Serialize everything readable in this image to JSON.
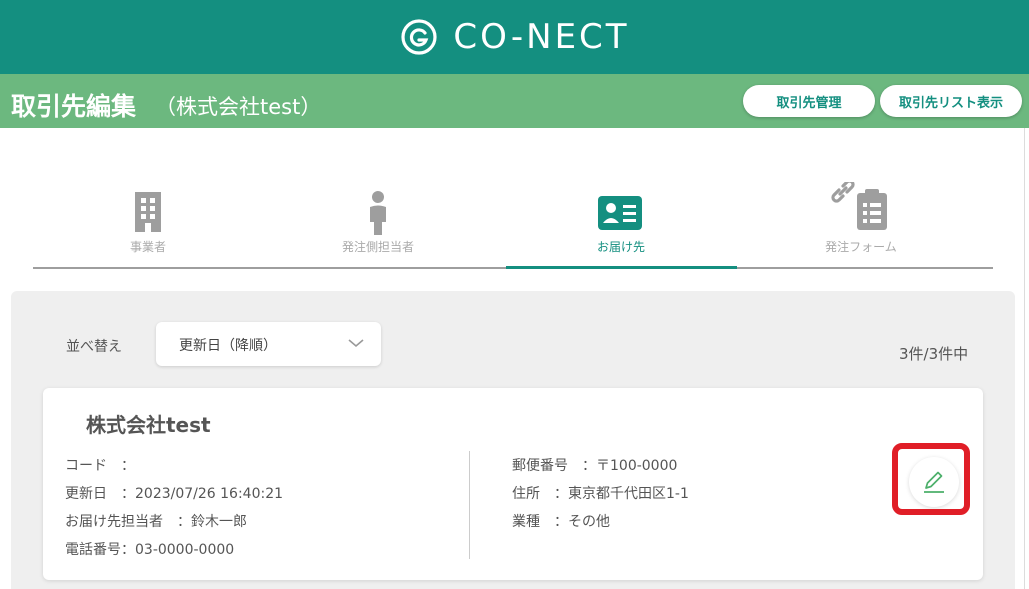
{
  "header": {
    "logo_text": "CO-NECT"
  },
  "title_bar": {
    "title": "取引先編集",
    "subtitle": "（株式会社test）",
    "btn_manage": "取引先管理",
    "btn_list": "取引先リスト表示"
  },
  "tabs": [
    {
      "label": "事業者",
      "icon": "building-icon"
    },
    {
      "label": "発注側担当者",
      "icon": "person-icon"
    },
    {
      "label": "お届け先",
      "icon": "contact-card-icon",
      "active": true
    },
    {
      "label": "発注フォーム",
      "icon": "clipboard-link-icon"
    }
  ],
  "sort": {
    "label": "並べ替え",
    "value": "更新日（降順）"
  },
  "count": "3件/3件中",
  "card": {
    "name": "株式会社test",
    "code": "コード　：",
    "updated": "更新日　：2023/07/26 16:40:21",
    "contact": "お届け先担当者　：鈴木一郎",
    "phone": "電話番号：03-0000-0000",
    "postal": "郵便番号　：〒100-0000",
    "address": "住所　：東京都千代田区1-1",
    "industry": "業種　：その他"
  },
  "colors": {
    "brand": "#148f80",
    "title_bar": "#6cb87f",
    "highlight": "#e01e27"
  }
}
